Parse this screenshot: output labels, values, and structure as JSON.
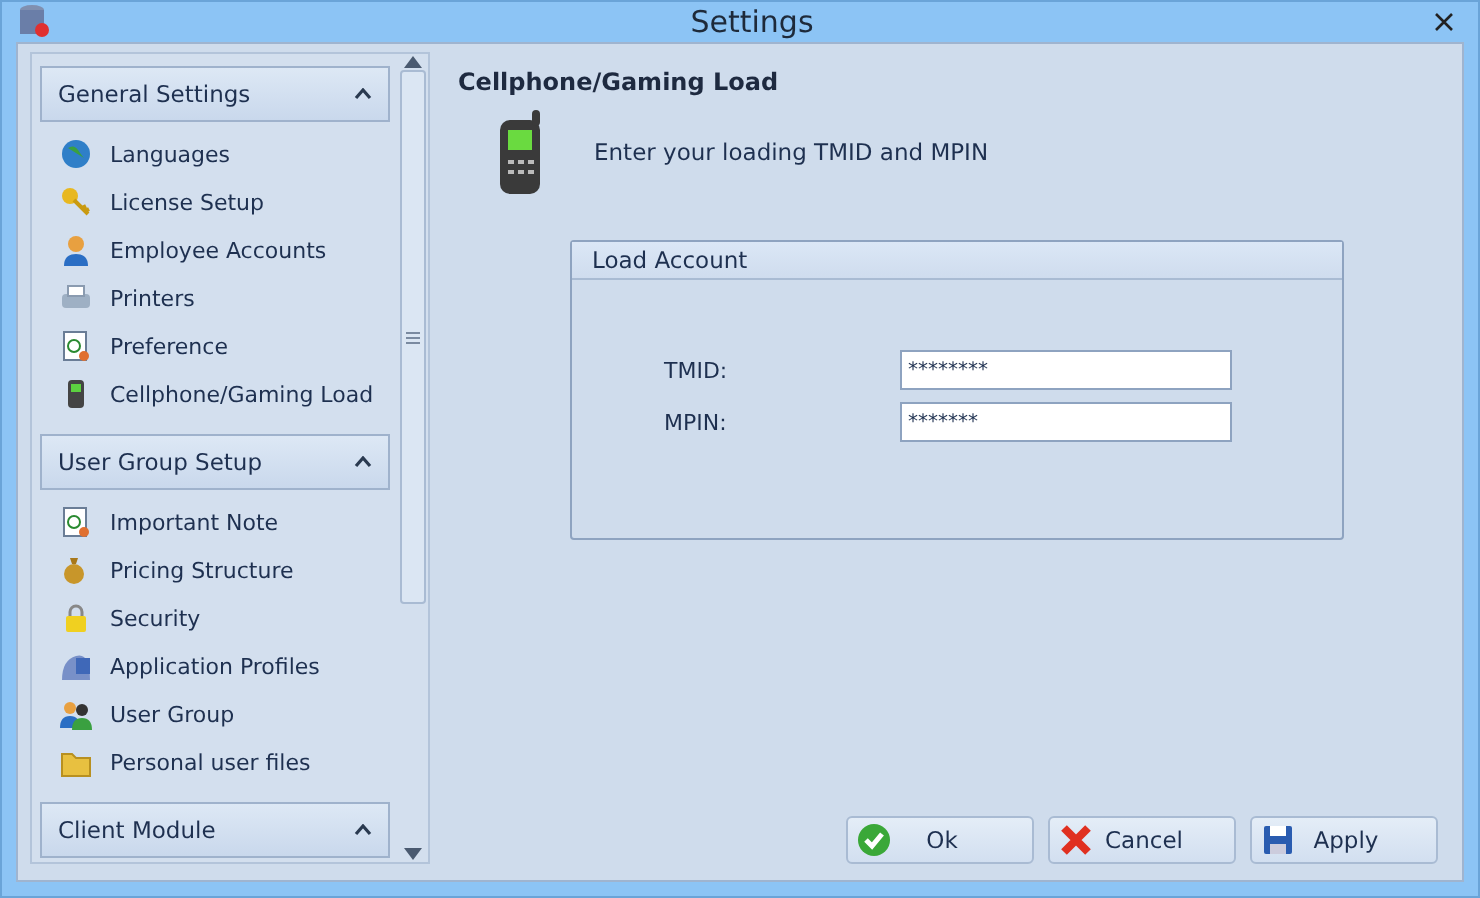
{
  "window": {
    "title": "Settings"
  },
  "sidebar": {
    "groups": [
      {
        "title": "General Settings",
        "expanded": true,
        "items": [
          {
            "label": "Languages",
            "kind": "globe"
          },
          {
            "label": "License Setup",
            "kind": "key"
          },
          {
            "label": "Employee Accounts",
            "kind": "person"
          },
          {
            "label": "Printers",
            "kind": "printer"
          },
          {
            "label": "Preference",
            "kind": "note"
          },
          {
            "label": "Cellphone/Gaming Load",
            "kind": "phone"
          }
        ]
      },
      {
        "title": "User Group Setup",
        "expanded": true,
        "items": [
          {
            "label": "Important Note",
            "kind": "note"
          },
          {
            "label": "Pricing Structure",
            "kind": "money"
          },
          {
            "label": "Security",
            "kind": "lock"
          },
          {
            "label": "Application Profiles",
            "kind": "profile"
          },
          {
            "label": "User Group",
            "kind": "people"
          },
          {
            "label": "Personal user files",
            "kind": "folder"
          }
        ]
      },
      {
        "title": "Client Module",
        "expanded": true
      }
    ]
  },
  "page": {
    "title": "Cellphone/Gaming Load",
    "instruction": "Enter your loading TMID and MPIN",
    "group": {
      "title": "Load Account",
      "fields": [
        {
          "label": "TMID:",
          "value": "********"
        },
        {
          "label": "MPIN:",
          "value": "*******"
        }
      ]
    }
  },
  "buttons": [
    {
      "label": "Ok",
      "kind": "ok"
    },
    {
      "label": "Cancel",
      "kind": "cancel"
    },
    {
      "label": "Apply",
      "kind": "save"
    }
  ]
}
